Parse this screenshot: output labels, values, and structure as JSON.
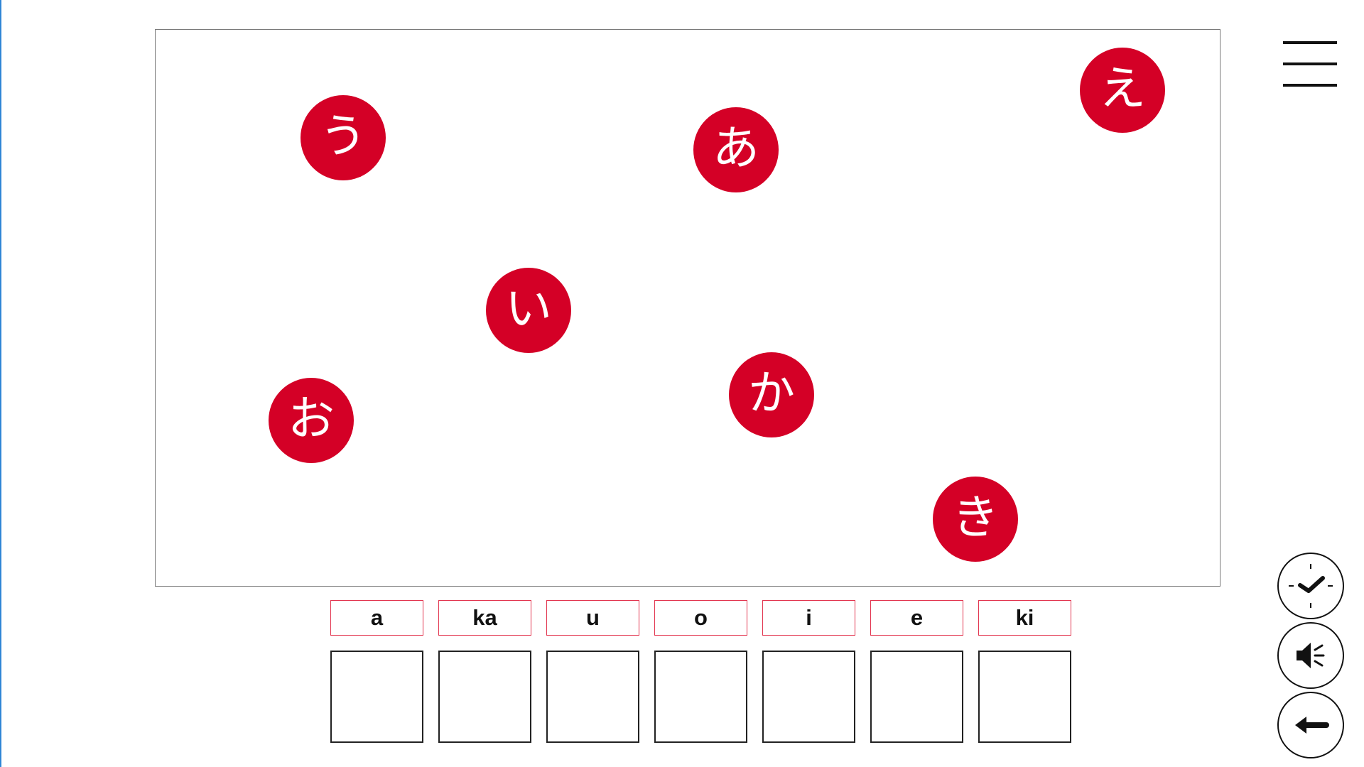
{
  "board": {
    "tiles": [
      {
        "id": "u",
        "char": "う"
      },
      {
        "id": "a",
        "char": "あ"
      },
      {
        "id": "e",
        "char": "え"
      },
      {
        "id": "i",
        "char": "い"
      },
      {
        "id": "o",
        "char": "お"
      },
      {
        "id": "ka",
        "char": "か"
      },
      {
        "id": "ki",
        "char": "き"
      }
    ]
  },
  "answers": {
    "labels": [
      "a",
      "ka",
      "u",
      "o",
      "i",
      "e",
      "ki"
    ]
  },
  "controls": {
    "menu_icon": "hamburger-menu-icon",
    "check_icon": "clock-check-icon",
    "sound_icon": "speaker-icon",
    "back_icon": "arrow-left-icon"
  },
  "colors": {
    "tile": "#d40026",
    "label_border": "#e2354f",
    "accent_edge": "#2f86d6"
  }
}
